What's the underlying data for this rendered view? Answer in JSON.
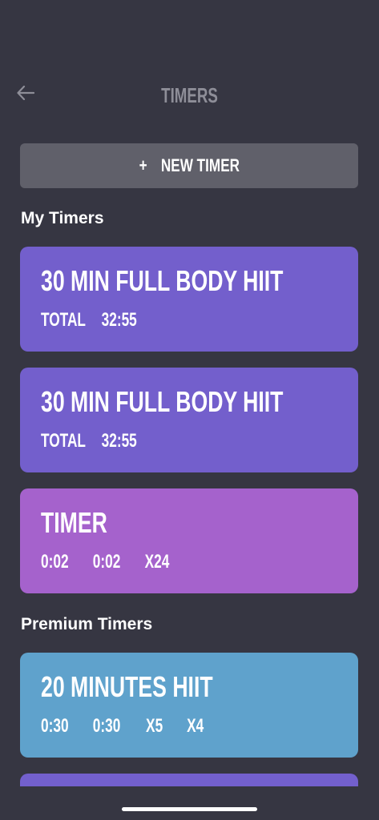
{
  "header": {
    "title": "TIMERS",
    "back_icon": "arrow-left-icon"
  },
  "new_timer": {
    "plus": "+",
    "label": "NEW TIMER"
  },
  "sections": {
    "my_timers": "My Timers",
    "premium_timers": "Premium Timers"
  },
  "my_timers": [
    {
      "title": "30 MIN FULL BODY HIIT",
      "stats": [
        "TOTAL",
        "32:55"
      ],
      "color": "#735fcc"
    },
    {
      "title": "30 MIN FULL BODY HIIT",
      "stats": [
        "TOTAL",
        "32:55"
      ],
      "color": "#735fcc"
    },
    {
      "title": "TIMER",
      "stats": [
        "0:02",
        "0:02",
        "X24"
      ],
      "color": "#a562cc"
    }
  ],
  "premium_timers": [
    {
      "title": "20 MINUTES HIIT",
      "stats": [
        "0:30",
        "0:30",
        "X5",
        "X4"
      ],
      "color": "#5fa2cc"
    }
  ],
  "colors": {
    "background": "#363642",
    "button": "#60606a",
    "title_gray": "#8e8e98"
  }
}
